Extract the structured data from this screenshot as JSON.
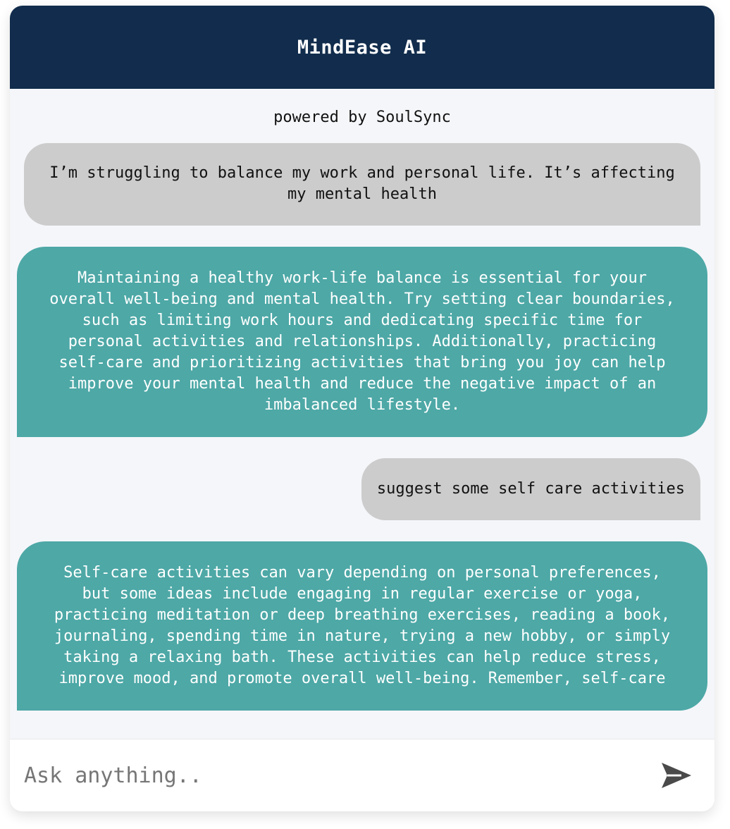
{
  "header": {
    "title": "MindEase AI"
  },
  "subtitle": "powered by SoulSync",
  "messages": [
    {
      "role": "user",
      "text": "I’m struggling to balance my work and personal life. It’s affecting my mental health"
    },
    {
      "role": "assistant",
      "text": "Maintaining a healthy work-life balance is essential for your overall well-being and mental health. Try setting clear boundaries, such as limiting work hours and dedicating specific time for personal activities and relationships. Additionally, practicing self-care and prioritizing activities that bring you joy can help improve your mental health and reduce the negative impact of an imbalanced lifestyle."
    },
    {
      "role": "user",
      "text": "suggest some self care activities"
    },
    {
      "role": "assistant",
      "text": "Self-care activities can vary depending on personal preferences, but some ideas include engaging in regular exercise or yoga, practicing meditation or deep breathing exercises, reading a book, journaling, spending time in nature, trying a new hobby, or simply taking a relaxing bath. These activities can help reduce stress, improve mood, and promote overall well-being. Remember, self-care"
    }
  ],
  "input": {
    "placeholder": "Ask anything..",
    "value": ""
  },
  "icons": {
    "send": "send-icon"
  },
  "colors": {
    "header_bg": "#112c4c",
    "user_bubble": "#cccccc",
    "assistant_bubble": "#4da8a6",
    "chat_bg": "#f5f6fa"
  }
}
